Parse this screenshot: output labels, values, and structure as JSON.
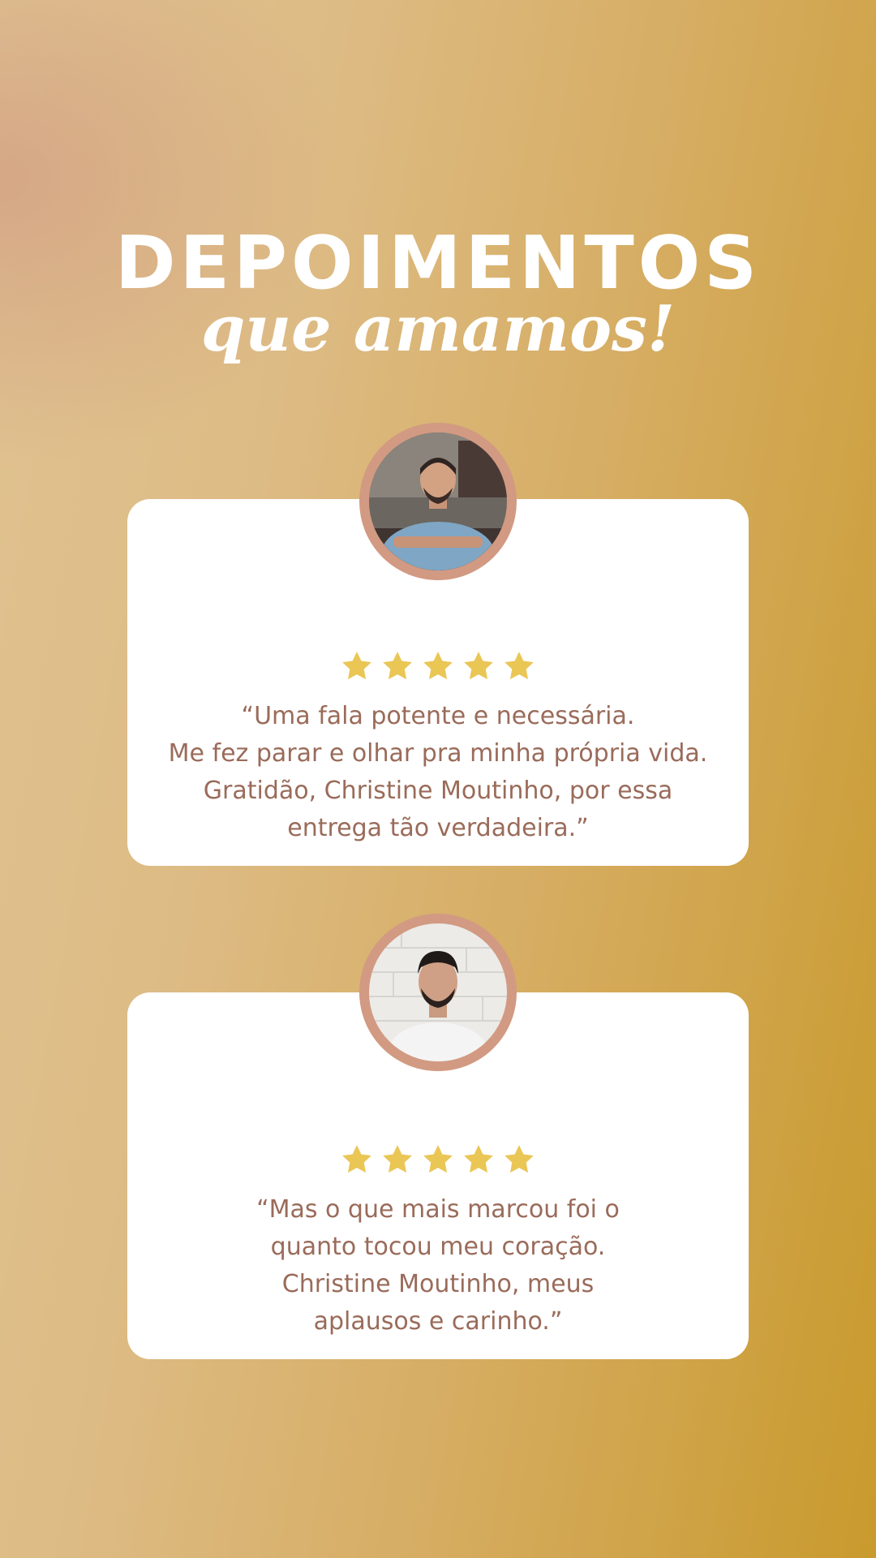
{
  "header": {
    "title": "DEPOIMENTOS",
    "subtitle": "que amamos!"
  },
  "colors": {
    "accent_star": "#eac655",
    "text_quote": "#9a6b5a",
    "avatar_ring": "#d29a82",
    "gradient_start": "#e0c392",
    "gradient_end": "#c99a2d"
  },
  "testimonials": [
    {
      "rating": 5,
      "rating_max": 5,
      "quote_lines": [
        "“Uma fala potente e necessária.",
        "Me fez parar e olhar pra minha própria vida.",
        "Gratidão, Christine Moutinho, por essa",
        "entrega tão verdadeira.”"
      ]
    },
    {
      "rating": 5,
      "rating_max": 5,
      "quote_lines": [
        "“Mas o que mais marcou foi o",
        "quanto tocou meu coração.",
        "Christine Moutinho, meus",
        "aplausos e carinho.”"
      ]
    }
  ]
}
